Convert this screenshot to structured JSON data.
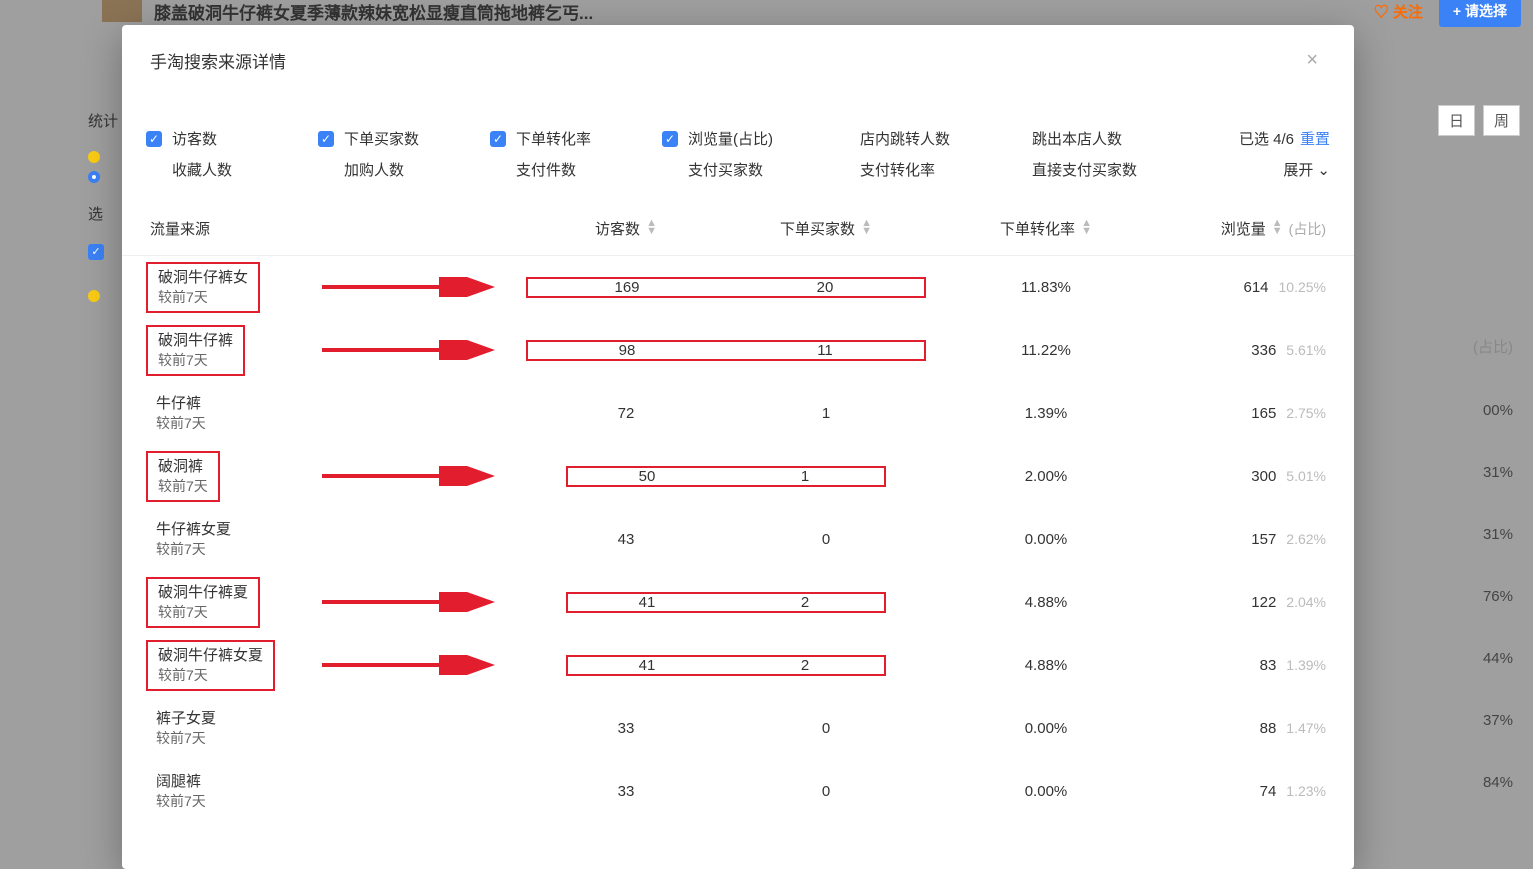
{
  "bg": {
    "product_title": "膝盖破洞牛仔裤女夏季薄款辣妹宽松显瘦直筒拖地裤乞丐...",
    "favorite": "关注",
    "select_btn": "+ 请选择",
    "stats_label": "统计",
    "select_label": "选",
    "day_btn": "日",
    "week_btn": "周",
    "ratio_header": "(占比)",
    "row_pcts": [
      "00%",
      "31%",
      "31%",
      "76%",
      "44%",
      "37%",
      "84%"
    ]
  },
  "modal": {
    "title": "手淘搜索来源详情",
    "close_icon": "×",
    "selected_prefix": "已选 ",
    "selected_count": "4/6",
    "reset": "重置",
    "expand": "展开"
  },
  "filters": {
    "r1": [
      {
        "label": "访客数",
        "checked": true
      },
      {
        "label": "下单买家数",
        "checked": true
      },
      {
        "label": "下单转化率",
        "checked": true
      },
      {
        "label": "浏览量(占比)",
        "checked": true
      },
      {
        "label": "店内跳转人数",
        "checked": false,
        "nobox": true
      },
      {
        "label": "跳出本店人数",
        "checked": false,
        "nobox": true
      }
    ],
    "r2": [
      {
        "label": "收藏人数"
      },
      {
        "label": "加购人数"
      },
      {
        "label": "支付件数"
      },
      {
        "label": "支付买家数"
      },
      {
        "label": "支付转化率"
      },
      {
        "label": "直接支付买家数"
      }
    ]
  },
  "thead": {
    "source": "流量来源",
    "visitors": "访客数",
    "buyers": "下单买家数",
    "rate": "下单转化率",
    "views": "浏览量",
    "ratio": "(占比)"
  },
  "rows": [
    {
      "kw": "破洞牛仔裤女",
      "sub": "较前7天",
      "v": "169",
      "b": "20",
      "rate": "11.83%",
      "views": "614",
      "pct": "10.25%",
      "boxSrc": true,
      "arrow": true,
      "boxNum": "wide"
    },
    {
      "kw": "破洞牛仔裤",
      "sub": "较前7天",
      "v": "98",
      "b": "11",
      "rate": "11.22%",
      "views": "336",
      "pct": "5.61%",
      "boxSrc": true,
      "arrow": true,
      "boxNum": "wide"
    },
    {
      "kw": "牛仔裤",
      "sub": "较前7天",
      "v": "72",
      "b": "1",
      "rate": "1.39%",
      "views": "165",
      "pct": "2.75%"
    },
    {
      "kw": "破洞裤",
      "sub": "较前7天",
      "v": "50",
      "b": "1",
      "rate": "2.00%",
      "views": "300",
      "pct": "5.01%",
      "boxSrc": true,
      "arrow": true,
      "boxNum": "narrow"
    },
    {
      "kw": "牛仔裤女夏",
      "sub": "较前7天",
      "v": "43",
      "b": "0",
      "rate": "0.00%",
      "views": "157",
      "pct": "2.62%"
    },
    {
      "kw": "破洞牛仔裤夏",
      "sub": "较前7天",
      "v": "41",
      "b": "2",
      "rate": "4.88%",
      "views": "122",
      "pct": "2.04%",
      "boxSrc": true,
      "arrow": true,
      "boxNum": "narrow"
    },
    {
      "kw": "破洞牛仔裤女夏",
      "sub": "较前7天",
      "v": "41",
      "b": "2",
      "rate": "4.88%",
      "views": "83",
      "pct": "1.39%",
      "boxSrc": true,
      "arrow": true,
      "boxNum": "narrow"
    },
    {
      "kw": "裤子女夏",
      "sub": "较前7天",
      "v": "33",
      "b": "0",
      "rate": "0.00%",
      "views": "88",
      "pct": "1.47%"
    },
    {
      "kw": "阔腿裤",
      "sub": "较前7天",
      "v": "33",
      "b": "0",
      "rate": "0.00%",
      "views": "74",
      "pct": "1.23%"
    }
  ]
}
